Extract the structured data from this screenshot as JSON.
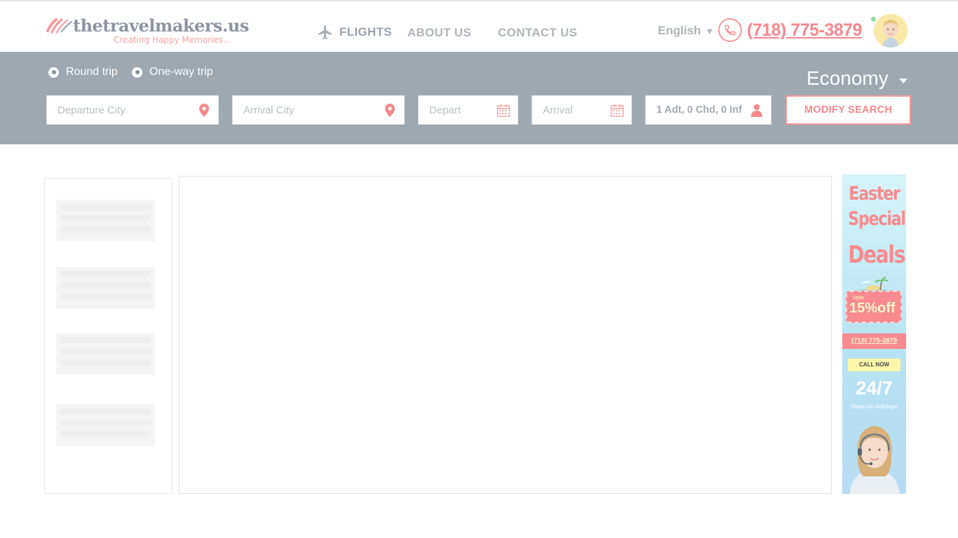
{
  "header": {
    "logo_text": "thetravelmakers.us",
    "logo_tagline": "Creating Happy Memories...",
    "nav": [
      {
        "label": "FLIGHTS",
        "icon": "airplane-icon",
        "active": true
      },
      {
        "label": "ABOUT US",
        "active": false
      },
      {
        "label": "CONTACT US",
        "active": false
      }
    ],
    "language": "English",
    "phone": "(718) 775-3879",
    "colors": {
      "accent": "#f7898e",
      "nav": "#b0b4ba",
      "online": "#8fe0a0"
    }
  },
  "search": {
    "trip_types": [
      {
        "label": "Round trip",
        "selected": true
      },
      {
        "label": "One-way trip",
        "selected": false
      }
    ],
    "cabin_class": "Economy",
    "departure_placeholder": "Departure City",
    "arrival_placeholder": "Arrival City",
    "depart_placeholder": "Depart",
    "return_placeholder": "Arrival",
    "passengers": "1 Adt, 0 Chd, 0 Inf",
    "modify_button": "MODIFY SEARCH",
    "bar_color": "#9da8b1"
  },
  "ad": {
    "line1": "Easter",
    "line2": "Special",
    "line3": "Deals",
    "upto": "Upto",
    "discount": "15%off",
    "phone": "(718) 775-3879",
    "call_now": "CALL NOW",
    "hours": "24/7",
    "open_text": "Open on holidays"
  }
}
